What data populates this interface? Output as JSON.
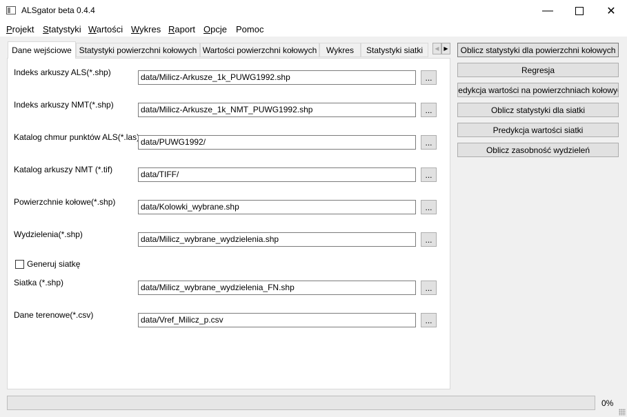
{
  "window": {
    "title": "ALSgator beta 0.4.4"
  },
  "menu": [
    {
      "acc": "P",
      "rest": "rojekt"
    },
    {
      "acc": "S",
      "rest": "tatystyki"
    },
    {
      "acc": "W",
      "rest": "artości"
    },
    {
      "acc": "W",
      "rest": "ykres"
    },
    {
      "acc": "R",
      "rest": "aport"
    },
    {
      "acc": "O",
      "rest": "pcje"
    },
    {
      "acc": "",
      "rest": "Pomoc"
    }
  ],
  "tabs": [
    "Dane wejściowe",
    "Statystyki powierzchni kołowych",
    "Wartości powierzchni kołowych",
    "Wykres",
    "Statystyki siatki"
  ],
  "fields": [
    {
      "label": "Indeks arkuszy ALS(*.shp)",
      "value": "data/Milicz-Arkusze_1k_PUWG1992.shp"
    },
    {
      "label": "Indeks arkuszy NMT(*.shp)",
      "value": "data/Milicz-Arkusze_1k_NMT_PUWG1992.shp"
    },
    {
      "label": "Katalog chmur punktów ALS(*.las)",
      "value": "data/PUWG1992/"
    },
    {
      "label": "Katalog arkuszy NMT (*.tif)",
      "value": "data/TIFF/"
    },
    {
      "label": "Powierzchnie kołowe(*.shp)",
      "value": "data/Kolowki_wybrane.shp"
    },
    {
      "label": "Wydzielenia(*.shp)",
      "value": "data/Milicz_wybrane_wydzielenia.shp"
    },
    {
      "label": "Siatka (*.shp)",
      "value": "data/Milicz_wybrane_wydzielenia_FN.shp"
    },
    {
      "label": "Dane terenowe(*.csv)",
      "value": "data/Vref_Milicz_p.csv"
    }
  ],
  "browse_label": "...",
  "checkbox": {
    "label": "Generuj siatkę",
    "checked": false
  },
  "actions": [
    "Oblicz statystyki dla powierzchni kołowych",
    "Regresja",
    "Predykcja wartości na powierzchniach kołowych",
    "Oblicz statystyki dla siatki",
    "Predykcja wartości siatki",
    "Oblicz zasobność wydzieleń"
  ],
  "progress": {
    "percent": 0,
    "text": "0%"
  }
}
